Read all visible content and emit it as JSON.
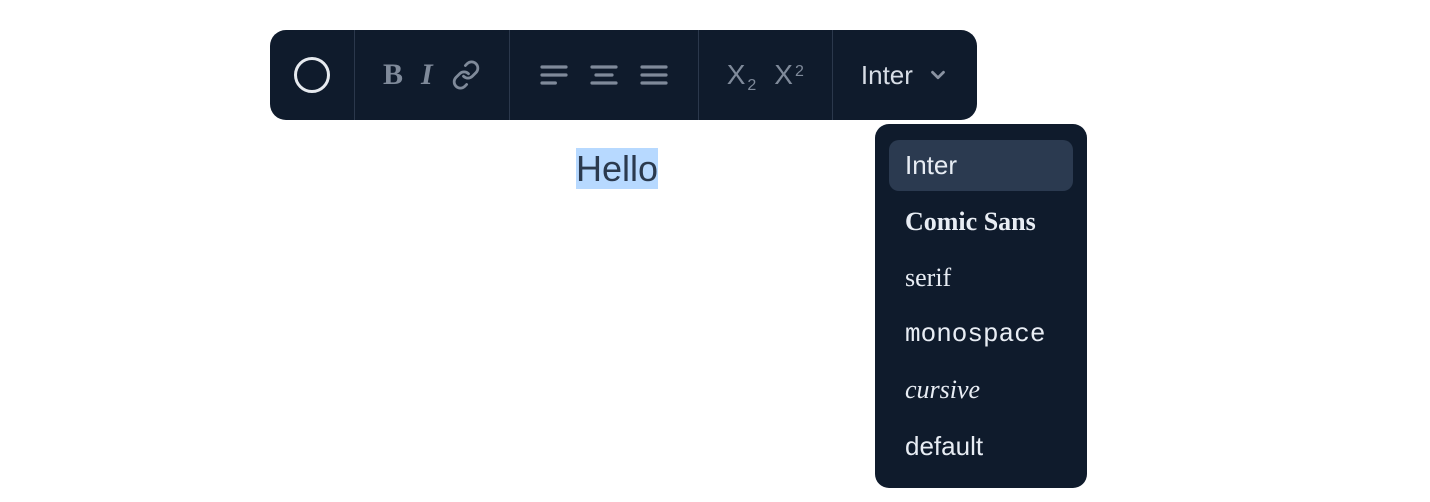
{
  "toolbar": {
    "font_select_label": "Inter"
  },
  "editor": {
    "text": "Hello"
  },
  "dropdown": {
    "items": [
      {
        "label": "Inter",
        "class": "ff-inter",
        "selected": true
      },
      {
        "label": "Comic Sans",
        "class": "ff-comic",
        "selected": false
      },
      {
        "label": "serif",
        "class": "ff-serif",
        "selected": false
      },
      {
        "label": "monospace",
        "class": "ff-mono",
        "selected": false
      },
      {
        "label": "cursive",
        "class": "ff-cursive",
        "selected": false
      },
      {
        "label": "default",
        "class": "ff-default",
        "selected": false
      }
    ]
  }
}
